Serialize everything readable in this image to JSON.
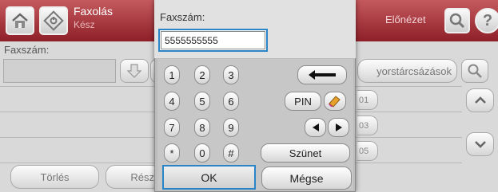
{
  "header": {
    "app_title": "Faxolás",
    "status": "Kész",
    "preview_label": "Előnézet",
    "home_icon": "home-icon",
    "start_icon": "start-icon",
    "help_icon": "help-icon"
  },
  "background": {
    "field_label": "Faxszám:",
    "speed_dial_label": "yorstárcsázások",
    "speed_entries": [
      "01",
      "03",
      "05"
    ],
    "delete_button": "Törlés",
    "resolution_button": "Rész"
  },
  "dialog": {
    "label": "Faxszám:",
    "input_value": "5555555555",
    "keys": [
      [
        "1",
        "2",
        "3"
      ],
      [
        "4",
        "5",
        "6"
      ],
      [
        "7",
        "8",
        "9"
      ],
      [
        "*",
        "0",
        "#"
      ]
    ],
    "backspace_symbol": "←",
    "pin_label": "PIN",
    "pause_label": "Szünet",
    "ok_label": "OK",
    "cancel_label": "Mégse"
  },
  "colors": {
    "header_top": "#c45a5e",
    "header_bottom": "#8e1f28",
    "focus_blue": "#2a84c8"
  }
}
